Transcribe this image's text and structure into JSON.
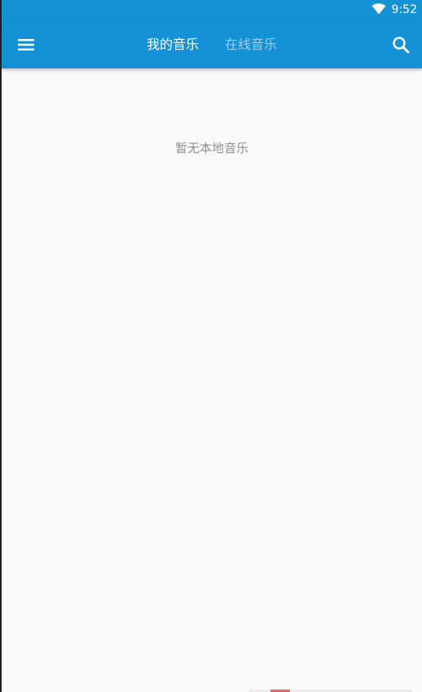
{
  "status_bar": {
    "time": "9:52",
    "wifi_icon": "wifi-icon"
  },
  "toolbar": {
    "menu_icon": "menu-icon",
    "search_icon": "search-icon",
    "tabs": [
      {
        "label": "我的音乐",
        "selected": true
      },
      {
        "label": "在线音乐",
        "selected": false
      }
    ]
  },
  "main": {
    "empty_message": "暂无本地音乐"
  },
  "colors": {
    "primary": "#1591d6",
    "tab_active": "#ffffff",
    "tab_inactive": "#9cccec",
    "background": "#fafafa",
    "empty_text": "#8f8f8f"
  }
}
